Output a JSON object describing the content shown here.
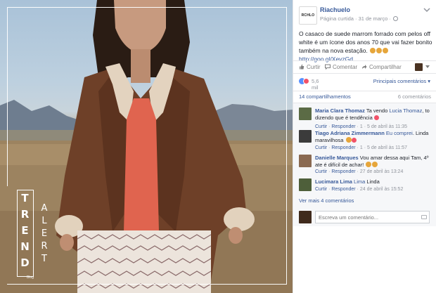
{
  "photo": {
    "badge_letters": [
      "T",
      "R",
      "E",
      "N",
      "D"
    ],
    "badge_small": "Blog",
    "side_letters": [
      "A",
      "L",
      "E",
      "R",
      "T"
    ]
  },
  "post": {
    "logo_text": "RCHLO",
    "page_name": "Riachuelo",
    "meta": "Página curtida · 31 de março ·",
    "text": "O casaco de suede marrom forrado com pelos off white é um ícone dos anos 70 que vai fazer bonito também na nova estação.",
    "link": "http://goo.gl/XevzGd"
  },
  "actions": {
    "like": "Curtir",
    "comment": "Comentar",
    "share": "Compartilhar"
  },
  "reactions": {
    "count": "5,6 mil",
    "relevance_label": "Principais comentários",
    "shares": "14 compartilhamentos",
    "comments_count": "6 comentários"
  },
  "comments": [
    {
      "name": "Maria Clara Thomaz",
      "text": "Ta vendo",
      "tag": "Lucia Thomaz",
      "text2": ", to dizendo que é tendência",
      "like": "Curtir",
      "reply": "Responder",
      "likes": "1",
      "date": "5 de abril às 11:35",
      "avatar_color": "#5b6b45"
    },
    {
      "name": "Tiago Adriana Zimmermann",
      "tag": "Eu comprei",
      "text": ". Linda maravilhosa",
      "like": "Curtir",
      "reply": "Responder",
      "likes": "1",
      "date": "5 de abril às 11:57",
      "avatar_color": "#3b3b3b"
    },
    {
      "name": "Danielle Marques",
      "text": "Vou amar dessa aqui Tam, 4º ate é difícil de achar!",
      "like": "Curtir",
      "reply": "Responder",
      "date": "27 de abril às 13:24",
      "avatar_color": "#8a6a52"
    },
    {
      "name": "Lucimara Lima",
      "tag": "Lima",
      "text": "Linda",
      "like": "Curtir",
      "reply": "Responder",
      "date": "24 de abril às 15:52",
      "avatar_color": "#4e5f3a"
    }
  ],
  "more_comments": "Ver mais 4 comentários",
  "composer": {
    "placeholder": "Escreva um comentário..."
  }
}
